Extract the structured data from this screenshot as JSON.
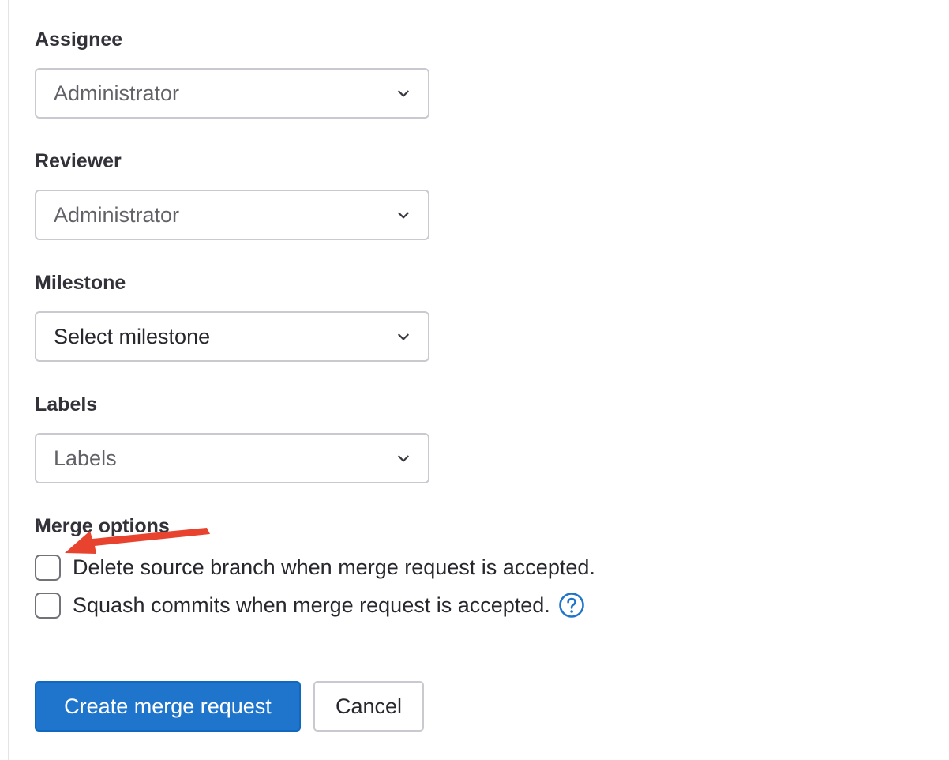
{
  "assignee": {
    "label": "Assignee",
    "value": "Administrator"
  },
  "reviewer": {
    "label": "Reviewer",
    "value": "Administrator"
  },
  "milestone": {
    "label": "Milestone",
    "value": "Select milestone"
  },
  "labels": {
    "label": "Labels",
    "value": "Labels"
  },
  "merge_options": {
    "title": "Merge options",
    "delete_source_branch": {
      "label": "Delete source branch when merge request is accepted.",
      "checked": false
    },
    "squash_commits": {
      "label": "Squash commits when merge request is accepted.",
      "checked": false,
      "help_icon": "question-circle-icon"
    }
  },
  "actions": {
    "create_label": "Create merge request",
    "cancel_label": "Cancel"
  },
  "icons": {
    "dropdown": "chevron-down-icon",
    "annotation": "red-arrow-annotation"
  },
  "colors": {
    "primary": "#1f75cb",
    "help_icon": "#1f75cb",
    "annotation_arrow": "#e8432e",
    "border": "#c9c9cf"
  }
}
